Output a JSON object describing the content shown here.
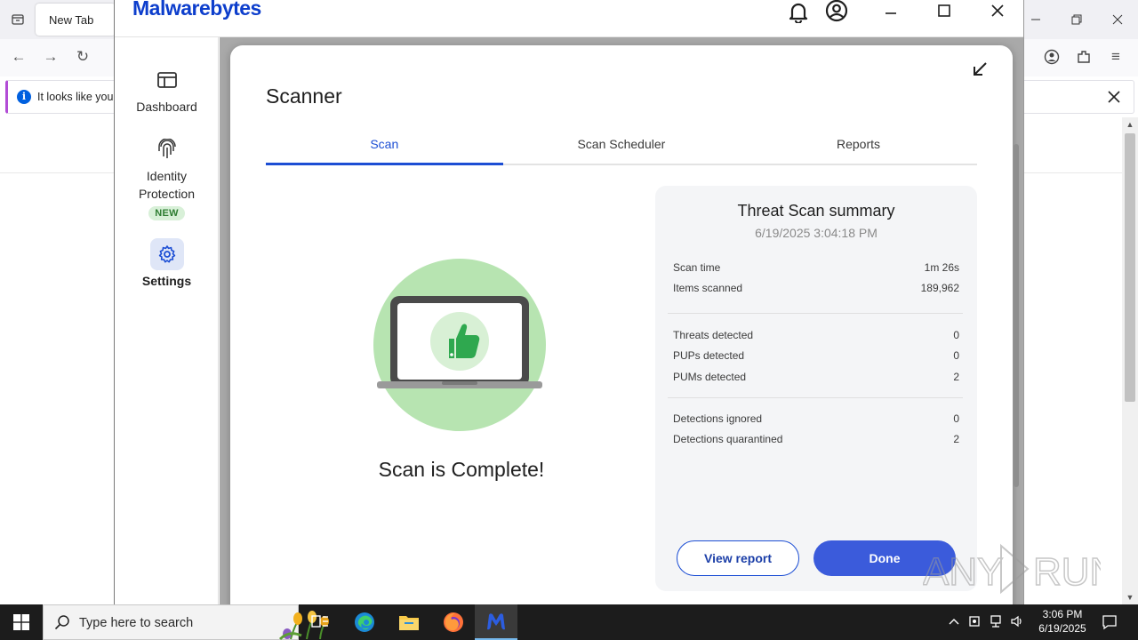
{
  "browser": {
    "tab_title": "New Tab",
    "notification_text": "It looks like you",
    "notification_close": "✕"
  },
  "app": {
    "logo_text": "Malwarebytes",
    "brand_color": "#0d3ecc"
  },
  "sidebar": {
    "items": [
      {
        "label": "Dashboard",
        "icon": "dashboard-icon"
      },
      {
        "label": "Identity Protection",
        "badge": "NEW",
        "icon": "fingerprint-icon"
      },
      {
        "label": "Settings",
        "icon": "gear-icon"
      }
    ]
  },
  "scanner": {
    "title": "Scanner",
    "tabs": [
      {
        "label": "Scan",
        "active": true
      },
      {
        "label": "Scan Scheduler",
        "active": false
      },
      {
        "label": "Reports",
        "active": false
      }
    ],
    "status_text": "Scan is Complete!"
  },
  "summary": {
    "title": "Threat Scan summary",
    "date": "6/19/2025 3:04:18 PM",
    "group1": [
      {
        "label": "Scan time",
        "value": "1m 26s"
      },
      {
        "label": "Items scanned",
        "value": "189,962"
      }
    ],
    "group2": [
      {
        "label": "Threats detected",
        "value": "0"
      },
      {
        "label": "PUPs detected",
        "value": "0"
      },
      {
        "label": "PUMs detected",
        "value": "2"
      }
    ],
    "group3": [
      {
        "label": "Detections ignored",
        "value": "0"
      },
      {
        "label": "Detections quarantined",
        "value": "2"
      }
    ],
    "view_report_label": "View report",
    "done_label": "Done"
  },
  "taskbar": {
    "search_placeholder": "Type here to search",
    "time": "3:06 PM",
    "date": "6/19/2025"
  },
  "colors": {
    "accent": "#1c4ed4",
    "done_button": "#3b5bdb",
    "success_green": "#2fa84f"
  }
}
